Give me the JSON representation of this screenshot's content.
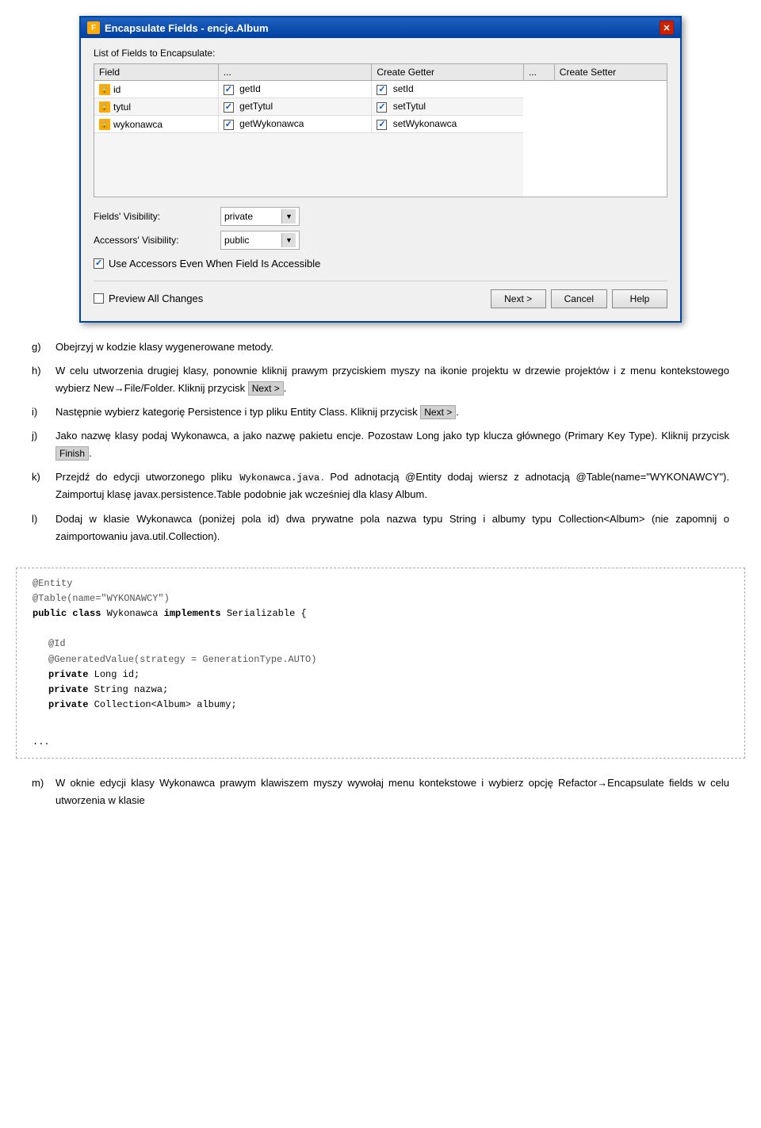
{
  "dialog": {
    "title": "Encapsulate Fields - encje.Album",
    "title_icon": "F",
    "section_label": "List of Fields to Encapsulate:",
    "table": {
      "columns": [
        "Field",
        "...",
        "Create Getter",
        "...",
        "Create Setter"
      ],
      "rows": [
        {
          "field": "id",
          "getter": "getId",
          "setter": "setId"
        },
        {
          "field": "tytul",
          "getter": "getTytul",
          "setter": "setTytul"
        },
        {
          "field": "wykonawca",
          "getter": "getWykonawca",
          "setter": "setWykonawca"
        }
      ]
    },
    "visibility": {
      "fields_label": "Fields' Visibility:",
      "fields_value": "private",
      "accessors_label": "Accessors' Visibility:",
      "accessors_value": "public"
    },
    "accessor_checkbox_label": "Use Accessors Even When Field Is Accessible",
    "preview_label": "Preview All Changes",
    "btn_next": "Next >",
    "btn_cancel": "Cancel",
    "btn_help": "Help"
  },
  "content": {
    "item_g": {
      "label": "g)",
      "text": "Obejrzyj w kodzie klasy wygenerowane metody."
    },
    "item_h": {
      "label": "h)",
      "text": "W celu utworzenia drugiej klasy, ponownie kliknij prawym przyciskiem myszy na ikonie projektu w drzewie projektów i z menu kontekstowego wybierz New→File/Folder. Kliknij przycisk ",
      "highlight": "Next >",
      "text_after": "."
    },
    "item_i": {
      "label": "i)",
      "text": "Następnie wybierz kategorię Persistence i typ pliku Entity Class. Kliknij przycisk ",
      "highlight": "Next >",
      "text_after": "."
    },
    "item_j": {
      "label": "j)",
      "text": "Jako nazwę klasy podaj Wykonawca, a jako nazwę pakietu encje. Pozostaw Long jako typ klucza głównego (Primary Key Type). Kliknij przycisk ",
      "highlight": "Finish",
      "text_after": "."
    },
    "item_k": {
      "label": "k)",
      "text_before": "Przejdź do edycji utworzonego pliku ",
      "code": "Wykonawca.java",
      "text": ". Pod adnotacją @Entity dodaj wiersz z adnotacją @Table(name=\"WYKONAWCY\"). Zaimportuj klasę javax.persistence.Table podobnie jak wcześniej dla klasy Album."
    },
    "item_l": {
      "label": "l)",
      "text": "Dodaj w klasie Wykonawca (poniżej pola id) dwa prywatne pola nazwa typu String i albumy typu Collection<Album> (nie zapomnij o zaimportowaniu java.util.Collection)."
    },
    "item_m": {
      "label": "m)",
      "text": "W oknie edycji klasy Wykonawca prawym klawiszem myszy wywołaj menu kontekstowe i wybierz opcję Refactor→Encapsulate fields w celu utworzenia w klasie"
    }
  },
  "code_block": {
    "line1": "@Entity",
    "line2": "@Table(name=\"WYKONAWCY\")",
    "line3": "public class Wykonawca implements Serializable {",
    "line4": "",
    "line5": "    @Id",
    "line6": "    @GeneratedValue(strategy = GenerationType.AUTO)",
    "line7": "    private Long id;",
    "line8": "    private String nazwa;",
    "line9": "    private Collection<Album> albumy;",
    "line10": "",
    "line11": "..."
  }
}
